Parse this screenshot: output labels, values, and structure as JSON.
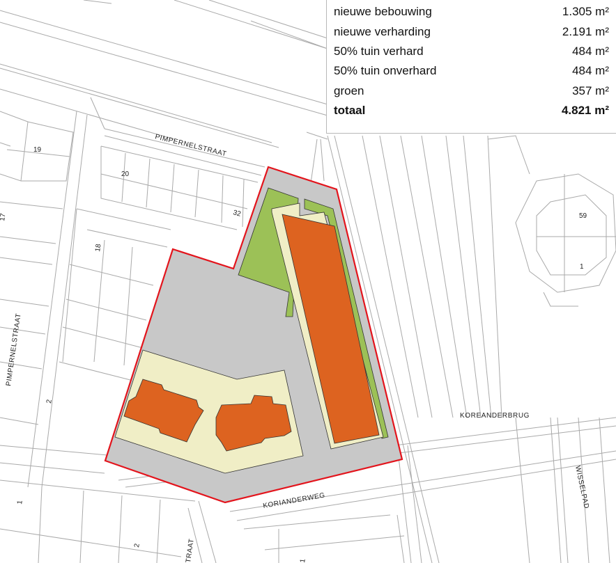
{
  "legend": {
    "rows": [
      {
        "label": "nieuwe bebouwing",
        "value": "1.305 m²"
      },
      {
        "label": "nieuwe verharding",
        "value": "2.191 m²"
      },
      {
        "label": "50% tuin verhard",
        "value": "484 m²"
      },
      {
        "label": "50% tuin onverhard",
        "value": "484 m²"
      },
      {
        "label": "groen",
        "value": "357 m²"
      }
    ],
    "total": {
      "label": "totaal",
      "value": "4.821 m²"
    }
  },
  "streets": {
    "pimpernelstraat_top": "PIMPERNELSTRAAT",
    "pimpernelstraat_left": "PIMPERNELSTRAAT",
    "koreanderbrug": "KOREANDERBRUG",
    "korianderweg": "KORIANDERWEG",
    "wisselpad": "WISSELPAD",
    "traat_bottom": "TRAAT"
  },
  "house_numbers": {
    "n19": "19",
    "n20": "20",
    "n32": "32",
    "n18": "18",
    "n17": "17",
    "n2_left": "2",
    "n1_bottom": "1",
    "n2_bottom": "2",
    "n1_bottom_mid": "1",
    "n59": "59",
    "n1_right": "1"
  },
  "colors": {
    "plan_boundary": "#e3141c",
    "paving": "#c8c8c8",
    "building": "#dd6320",
    "garden": "#f0eec6",
    "green": "#9cc157",
    "map_lines": "#a9a9a9"
  }
}
